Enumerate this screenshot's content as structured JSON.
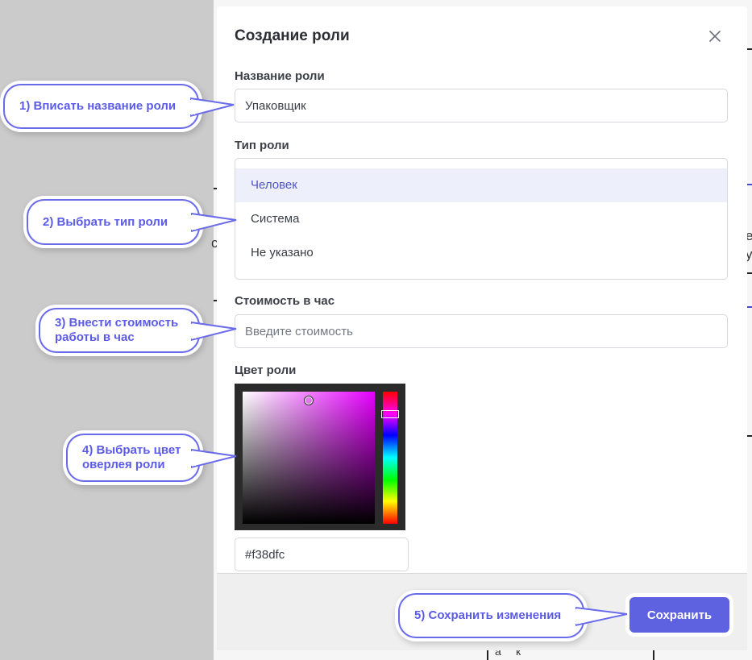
{
  "modal": {
    "title": "Создание роли",
    "close_icon": "close-icon"
  },
  "form": {
    "name_label": "Название роли",
    "name_value": "Упаковщик",
    "type_label": "Тип роли",
    "type_options": [
      "Человек",
      "Система",
      "Не указано"
    ],
    "type_selected": "Человек",
    "cost_label": "Стоимость в час",
    "cost_placeholder": "Введите стоимость",
    "color_label": "Цвет роли",
    "color_hex": "#f38dfc",
    "hue_color": "#e600ff"
  },
  "footer": {
    "save_label": "Сохранить"
  },
  "callouts": {
    "c1": "1) Вписать название роли",
    "c2": "2) Выбрать тип роли",
    "c3_line1": "3) Внести стоимость",
    "c3_line2": "работы в час",
    "c4_line1": "4) Выбрать цвет",
    "c4_line2": "оверлея роли",
    "c5": "5) Сохранить изменения"
  },
  "background": {
    "glyph_left": "c",
    "glyph_right_1": "e",
    "glyph_right_2": "y",
    "glyph_bottom_1": "а",
    "glyph_bottom_2": "к"
  },
  "colors": {
    "accent": "#5e61e0",
    "callout_text": "#5b5be8"
  }
}
